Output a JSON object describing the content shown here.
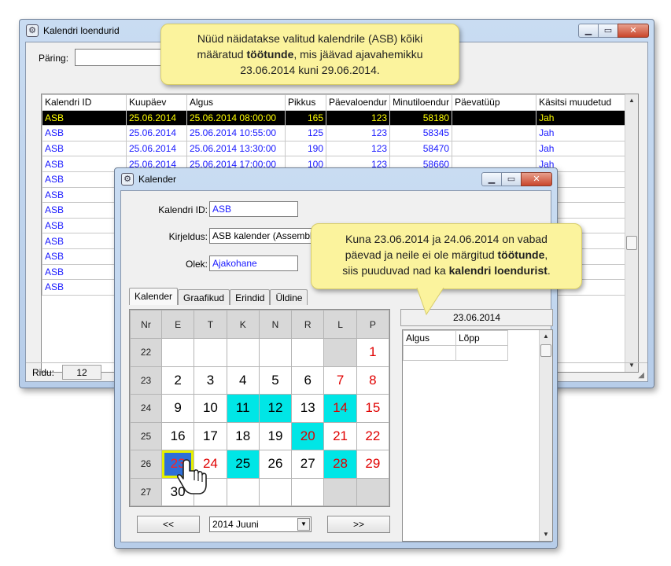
{
  "main_window": {
    "title": "Kalendri loendurid",
    "query_label": "Päring:",
    "query_value": "",
    "columns": [
      "Kalendri ID",
      "Kuupäev",
      "Algus",
      "Pikkus",
      "Päevaloendur",
      "Minutiloendur",
      "Päevatüüp",
      "Käsitsi muudetud"
    ],
    "rows": [
      [
        "ASB",
        "25.06.2014",
        "25.06.2014 08:00:00",
        "165",
        "123",
        "58180",
        "",
        "Jah"
      ],
      [
        "ASB",
        "25.06.2014",
        "25.06.2014 10:55:00",
        "125",
        "123",
        "58345",
        "",
        "Jah"
      ],
      [
        "ASB",
        "25.06.2014",
        "25.06.2014 13:30:00",
        "190",
        "123",
        "58470",
        "",
        "Jah"
      ],
      [
        "ASB",
        "25.06.2014",
        "25.06.2014 17:00:00",
        "100",
        "123",
        "58660",
        "",
        "Jah"
      ],
      [
        "ASB",
        "",
        "",
        "",
        "",
        "",
        "",
        ""
      ],
      [
        "ASB",
        "",
        "",
        "",
        "",
        "",
        "",
        ""
      ],
      [
        "ASB",
        "",
        "",
        "",
        "",
        "",
        "",
        ""
      ],
      [
        "ASB",
        "",
        "",
        "",
        "",
        "",
        "",
        ""
      ],
      [
        "ASB",
        "",
        "",
        "",
        "",
        "",
        "",
        ""
      ],
      [
        "ASB",
        "",
        "",
        "",
        "",
        "",
        "",
        ""
      ],
      [
        "ASB",
        "",
        "",
        "",
        "",
        "",
        "",
        ""
      ],
      [
        "ASB",
        "",
        "",
        "",
        "",
        "",
        "",
        ""
      ]
    ],
    "rows_label": "Ridu:",
    "rows_count": "12"
  },
  "callout_top": {
    "line1": "Nüüd näidatakse valitud kalendrile (ASB) kõiki",
    "line2_pre": "määratud ",
    "line2_bold": "töötunde",
    "line2_post": ", mis jäävad ajavahemikku",
    "line3": "23.06.2014 kuni 29.06.2014."
  },
  "callout_right": {
    "line1": "Kuna 23.06.2014 ja 24.06.2014 on vabad",
    "line2_pre": "päevad ja neile ei ole märgitud ",
    "line2_bold": "töötunde",
    "line2_post": ",",
    "line3_pre": "siis puuduvad nad ka ",
    "line3_bold": "kalendri loendurist",
    "line3_post": "."
  },
  "cal_window": {
    "title": "Kalender",
    "id_label": "Kalendri ID:",
    "id_value": "ASB",
    "desc_label": "Kirjeldus:",
    "desc_value": "ASB kalender (Assembly S",
    "state_label": "Olek:",
    "state_value": "Ajakohane",
    "tabs": [
      "Kalender",
      "Graafikud",
      "Erindid",
      "Üldine"
    ],
    "weekday_headers": [
      "Nr",
      "E",
      "T",
      "K",
      "N",
      "R",
      "L",
      "P"
    ],
    "weeks": [
      {
        "nr": "22",
        "days": [
          "",
          "",
          "",
          "",
          "",
          "",
          "1"
        ]
      },
      {
        "nr": "23",
        "days": [
          "2",
          "3",
          "4",
          "5",
          "6",
          "7",
          "8"
        ]
      },
      {
        "nr": "24",
        "days": [
          "9",
          "10",
          "11",
          "12",
          "13",
          "14",
          "15"
        ]
      },
      {
        "nr": "25",
        "days": [
          "16",
          "17",
          "18",
          "19",
          "20",
          "21",
          "22"
        ]
      },
      {
        "nr": "26",
        "days": [
          "23",
          "24",
          "25",
          "26",
          "27",
          "28",
          "29"
        ]
      },
      {
        "nr": "27",
        "days": [
          "30",
          "",
          "",
          "",
          "",
          "",
          ""
        ]
      }
    ],
    "prev_label": "<<",
    "next_label": ">>",
    "month_value": "2014 Juuni",
    "selected_date": "23.06.2014",
    "time_columns": [
      "Algus",
      "Lõpp"
    ]
  }
}
